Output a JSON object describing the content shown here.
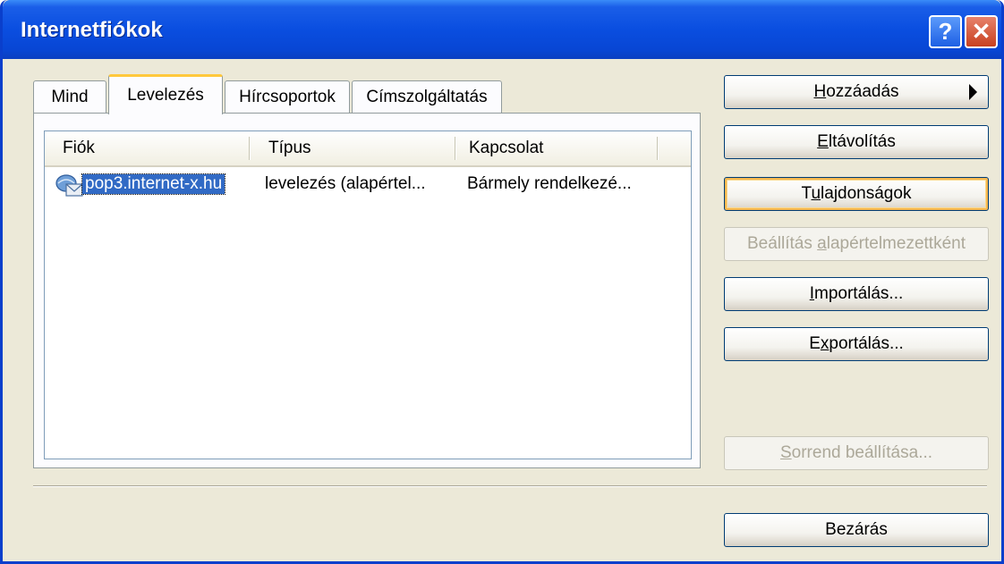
{
  "window": {
    "title": "Internetfiókok",
    "help_glyph": "?",
    "close_glyph": "✕"
  },
  "tabs": [
    {
      "label": "Mind",
      "active": false
    },
    {
      "label": "Levelezés",
      "active": true
    },
    {
      "label": "Hírcsoportok",
      "active": false
    },
    {
      "label": "Címszolgáltatás",
      "active": false
    }
  ],
  "list": {
    "columns": [
      "Fiók",
      "Típus",
      "Kapcsolat"
    ],
    "rows": [
      {
        "icon": "mail-account-icon",
        "account": "pop3.internet-x.hu",
        "type": "levelezés (alapértel...",
        "connection": "Bármely rendelkezé..."
      }
    ]
  },
  "buttons": {
    "add": {
      "pre": "",
      "key": "H",
      "post": "ozzáadás"
    },
    "remove": {
      "pre": "",
      "key": "E",
      "post": "ltávolítás"
    },
    "properties": {
      "pre": "T",
      "key": "u",
      "post": "lajdonságok"
    },
    "set_default": {
      "pre": "Beállítás ",
      "key": "a",
      "post": "lapértelmezettként"
    },
    "import": {
      "pre": "",
      "key": "I",
      "post": "mportálás..."
    },
    "export": {
      "pre": "E",
      "key": "x",
      "post": "portálás..."
    },
    "order": {
      "pre": "",
      "key": "S",
      "post": "orrend beállítása..."
    },
    "close": {
      "label": "Bezárás"
    }
  },
  "colors": {
    "titlebar": "#0a4ee0",
    "selection": "#316ac5",
    "dialog_bg": "#ece9d8"
  }
}
